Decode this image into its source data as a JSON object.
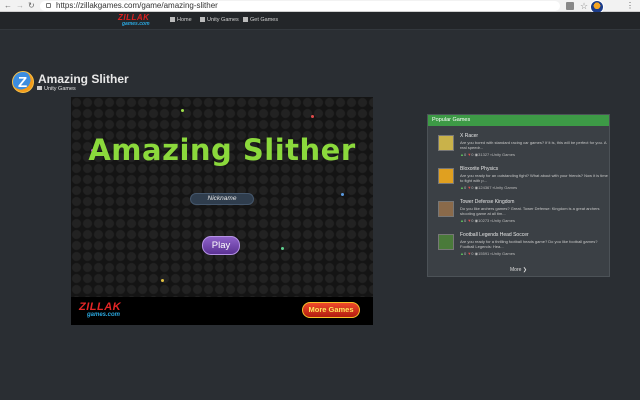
{
  "browser": {
    "url": "https://zillakgames.com/game/amazing-slither",
    "menu_glyph": "⋮",
    "back_glyph": "←",
    "forward_glyph": "→",
    "reload_glyph": "↻",
    "star_glyph": "☆"
  },
  "nav": {
    "logo_top": "ZILLAK",
    "logo_bottom": "games.com",
    "links": [
      {
        "label": "Home",
        "icon": "home-icon"
      },
      {
        "label": "Unity Games",
        "icon": "grid-icon"
      },
      {
        "label": "Get Games",
        "icon": "grid-icon"
      }
    ]
  },
  "page": {
    "title": "Amazing Slither",
    "category": "Unity Games",
    "logo_letter": "Z"
  },
  "game": {
    "title": "Amazing Slither",
    "nickname_placeholder": "Nickname",
    "play_label": "Play",
    "brand_top": "ZILLAK",
    "brand_bottom": "games.com",
    "more_games_label": "More Games",
    "colors": {
      "title": "#8bd93c",
      "play": "#7b4fb8",
      "more_games": "#d32a16"
    }
  },
  "popular": {
    "header": "Popular Games",
    "more_label": "More",
    "more_glyph": "❯",
    "items": [
      {
        "title": "X Racer",
        "description": "Are you bored with standard racing car games? If it is, this will be perfect for you. A real speedr...",
        "likes": "0",
        "dislikes": "0",
        "views": "31327",
        "category": "Unity Games",
        "thumb_color": "#c9b24a"
      },
      {
        "title": "Bloxorite Physics",
        "description": "Are you ready for an outstanding fight? What about with your friends? Now it is time to fight with p...",
        "likes": "0",
        "dislikes": "0",
        "views": "124367",
        "category": "Unity Games",
        "thumb_color": "#e0a020"
      },
      {
        "title": "Tower Defense Kingdom",
        "description": "Do you like archers games? Great. Tower Defense: Kingdom is a great archers shooting game at all tim...",
        "likes": "0",
        "dislikes": "0",
        "views": "10273",
        "category": "Unity Games",
        "thumb_color": "#8a6a4a"
      },
      {
        "title": "Football Legends Head Soccer",
        "description": "Are you ready for a thrilling football heads game? Do you like football games? Football Legends: Hea...",
        "likes": "0",
        "dislikes": "0",
        "views": "15591",
        "category": "Unity Games",
        "thumb_color": "#4a7a3a"
      }
    ]
  }
}
